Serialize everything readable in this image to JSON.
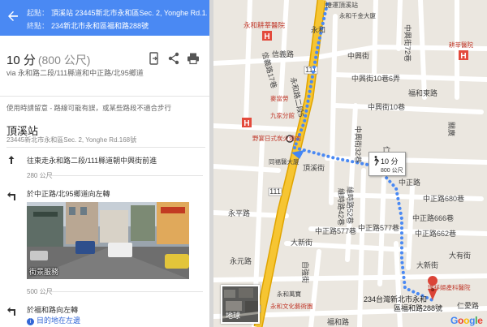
{
  "route": {
    "from_label": "起點：",
    "from_value": "頂溪站 23445新北市永和區Sec. 2, Yonghe Rd.1...",
    "to_label": "終點：",
    "to_value": "234新北市永和區福和路288號"
  },
  "summary": {
    "duration": "10 分",
    "distance": "(800 公尺)",
    "via": "via 永和路二段/111縣道和中正路/北95鄉道"
  },
  "warning": "使用時請留意 - 路線可能有誤，或某些路段不適合步行",
  "origin": {
    "name": "頂溪站",
    "address": "23445新北市永和區Sec. 2, Yonghe Rd.168號"
  },
  "steps": [
    {
      "text": "往東走永和路二段/111縣道朝中興街前進",
      "distance": "280 公尺",
      "icon": "straight-arrow-icon"
    },
    {
      "text": "於中正路/北95鄉道向左轉",
      "distance": "500 公尺",
      "icon": "turn-left-icon"
    },
    {
      "text": "於福和路向左轉",
      "distance": "",
      "icon": "turn-left-icon"
    }
  ],
  "street_view_label": "街景服務",
  "destination_note": "目的地在左邊",
  "map": {
    "walk_time": "10 分",
    "walk_distance": "800 公尺",
    "thumb_label": "地球",
    "google": [
      "G",
      "o",
      "o",
      "g",
      "l",
      "e"
    ],
    "destination_label_1": "234台灣新北市永和",
    "destination_label_2": "區福和路288號",
    "labels": {
      "station": "捷運頂溪站",
      "yonghe_plaza": "永和千金大廈",
      "yonghe_hospital": "永和耕莘醫院",
      "xinyi_17": "信義路17巷",
      "xinyi": "信義路",
      "zhongxing": "中興街",
      "zhongxing_72": "中興街72巷",
      "zhongxing_10_6": "中興街10巷6弄",
      "zhongxing_10": "中興街10巷",
      "yonghe_1": "永和",
      "guanguang": "關廣",
      "weiming_42": "維時路42巷",
      "zhongzheng_680": "中正路680巷",
      "zhongzheng_666": "中正路666巷",
      "zhongzheng_662": "中正路662巷",
      "zhongzheng_577_1": "中正路577巷",
      "zhongzheng_577_2": "中正路577巷",
      "zhongzheng_1": "中正路",
      "zhongzheng_609": "中正路609巷",
      "yongping": "永平路",
      "daxin": "大新街",
      "daxin_2": "大新街",
      "fuhe": "福和路",
      "yuhua": "自強街",
      "xiao": "仁愛街",
      "road_111a": "111",
      "road_111b": "111",
      "road_111c": "111",
      "liuxing": "福和東路",
      "ding": "頂溪街",
      "shop1": "麥當勞",
      "shop2": "野宴日式炭火燒肉",
      "shop3": "同福醫大廈",
      "hospital2": "耕莘醫院",
      "clinic": "瑞祥婦產科醫院",
      "yonghe_rd5": "永和路二段5",
      "zhongxing_32": "中興街32巷",
      "weiming_52": "維時路52巷",
      "xiao_2": "仁愛路",
      "yuanyi": "永元路",
      "dahu": "大有街",
      "culture_center": "永和文化藝術園",
      "jiuru": "九家分館",
      "yonghe_pub": "永和萬寶"
    }
  },
  "colors": {
    "header_blue": "#4a89f3",
    "route_blue": "#4a89f3",
    "main_road": "#f6b900",
    "destination_red": "#db4437"
  }
}
